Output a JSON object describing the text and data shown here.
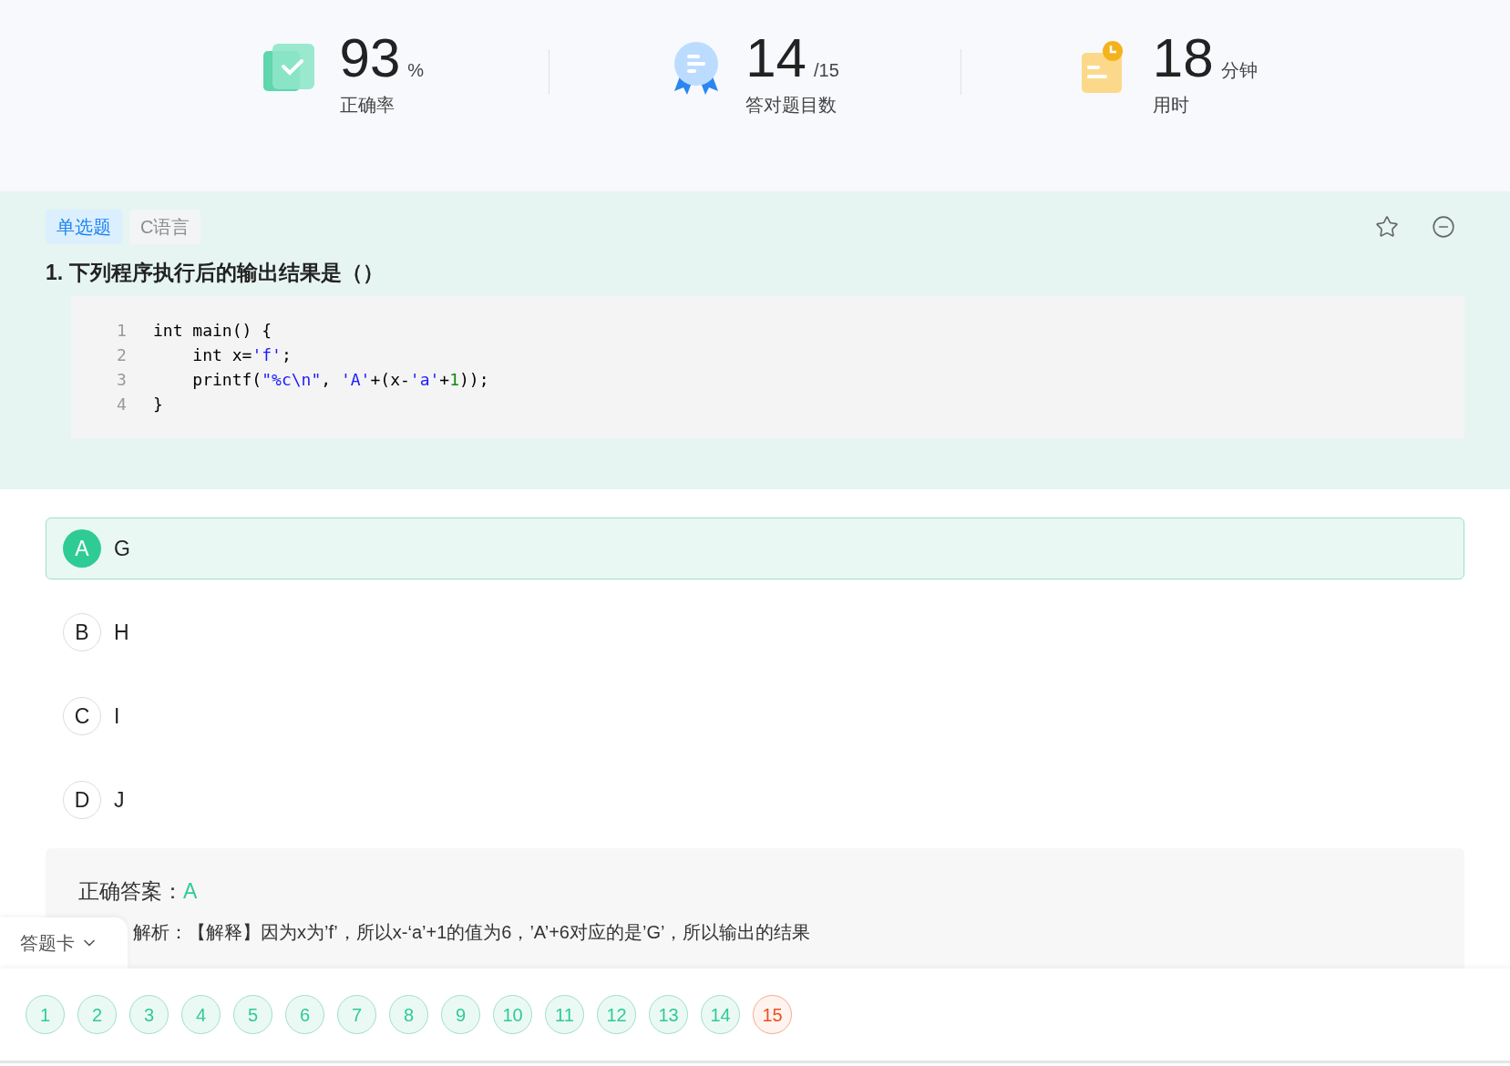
{
  "stats": [
    {
      "kind": "check",
      "value": "93",
      "unit": "%",
      "label": "正确率"
    },
    {
      "kind": "medal",
      "value": "14",
      "unit": "/15",
      "label": "答对题目数"
    },
    {
      "kind": "clock",
      "value": "18",
      "unit": "分钟",
      "label": "用时"
    }
  ],
  "question": {
    "tags": [
      {
        "kind": "type",
        "text": "单选题"
      },
      {
        "kind": "subject",
        "text": "C语言"
      }
    ],
    "title": "1. 下列程序执行后的输出结果是（）",
    "code": [
      {
        "number": "1",
        "tokens": [
          {
            "kind": "plain",
            "text": "int main() {"
          }
        ]
      },
      {
        "number": "2",
        "tokens": [
          {
            "kind": "plain",
            "text": "    int x="
          },
          {
            "kind": "string",
            "text": "'f'"
          },
          {
            "kind": "plain",
            "text": ";"
          }
        ]
      },
      {
        "number": "3",
        "tokens": [
          {
            "kind": "plain",
            "text": "    printf("
          },
          {
            "kind": "string",
            "text": "\"%c\\n\""
          },
          {
            "kind": "plain",
            "text": ", "
          },
          {
            "kind": "string",
            "text": "'A'"
          },
          {
            "kind": "plain",
            "text": "+(x-"
          },
          {
            "kind": "string",
            "text": "'a'"
          },
          {
            "kind": "plain",
            "text": "+"
          },
          {
            "kind": "number",
            "text": "1"
          },
          {
            "kind": "plain",
            "text": "));"
          }
        ]
      },
      {
        "number": "4",
        "tokens": [
          {
            "kind": "plain",
            "text": "}"
          }
        ]
      }
    ]
  },
  "options": [
    {
      "letter": "A",
      "text": "G",
      "selected": true
    },
    {
      "letter": "B",
      "text": "H",
      "selected": false
    },
    {
      "letter": "C",
      "text": "I",
      "selected": false
    },
    {
      "letter": "D",
      "text": "J",
      "selected": false
    }
  ],
  "answer": {
    "label": "正确答案：",
    "value": "A",
    "explanation": "解析：【解释】因为x为’f’，所以x-‘a’+1的值为6，’A’+6对应的是’G’，所以输出的结果"
  },
  "answer_card": {
    "label": "答题卡",
    "items": [
      {
        "text": "1",
        "correct": true
      },
      {
        "text": "2",
        "correct": true
      },
      {
        "text": "3",
        "correct": true
      },
      {
        "text": "4",
        "correct": true
      },
      {
        "text": "5",
        "correct": true
      },
      {
        "text": "6",
        "correct": true
      },
      {
        "text": "7",
        "correct": true
      },
      {
        "text": "8",
        "correct": true
      },
      {
        "text": "9",
        "correct": true
      },
      {
        "text": "10",
        "correct": true
      },
      {
        "text": "11",
        "correct": true
      },
      {
        "text": "12",
        "correct": true
      },
      {
        "text": "13",
        "correct": true
      },
      {
        "text": "14",
        "correct": true
      },
      {
        "text": "15",
        "correct": false
      }
    ]
  }
}
